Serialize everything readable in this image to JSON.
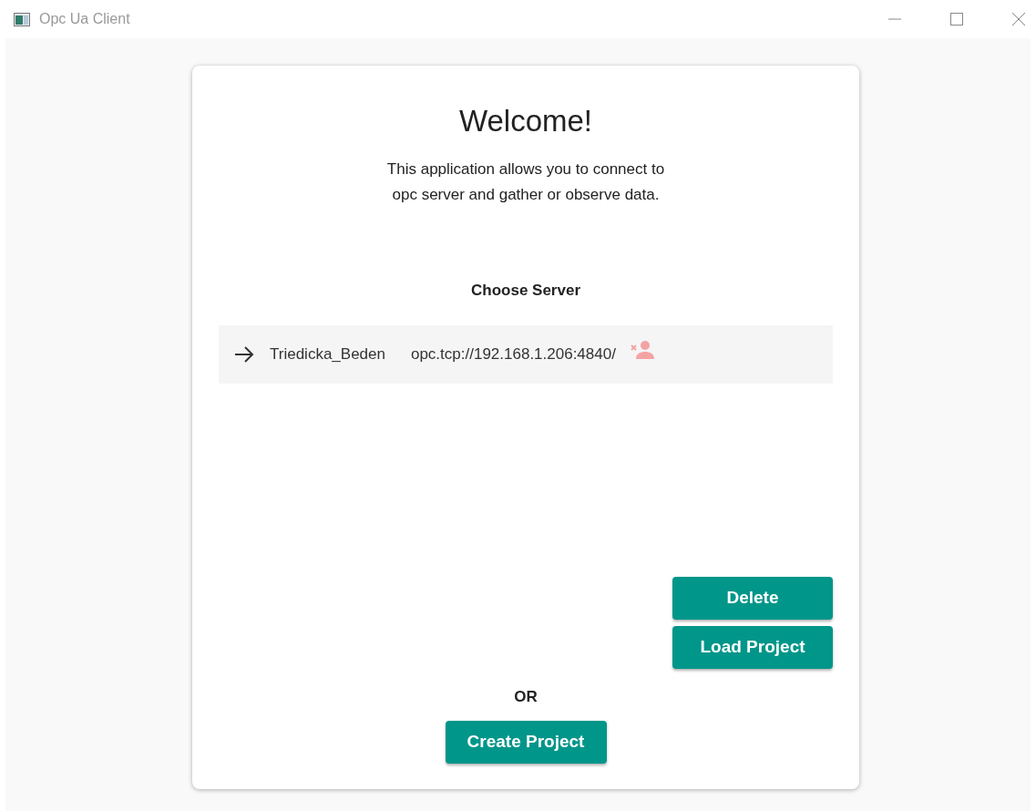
{
  "window": {
    "title": "Opc Ua Client"
  },
  "welcome": {
    "heading": "Welcome!",
    "description_lines": [
      "This application allows you to connect to",
      "opc server and gather or observe data."
    ]
  },
  "server_list": {
    "title": "Choose Server",
    "servers": [
      {
        "name": "Triedicka_Beden",
        "url": "opc.tcp://192.168.1.206:4840/"
      }
    ]
  },
  "actions": [
    "Delete",
    "Load Project"
  ],
  "separator": "OR",
  "create_button": "Create Project"
}
